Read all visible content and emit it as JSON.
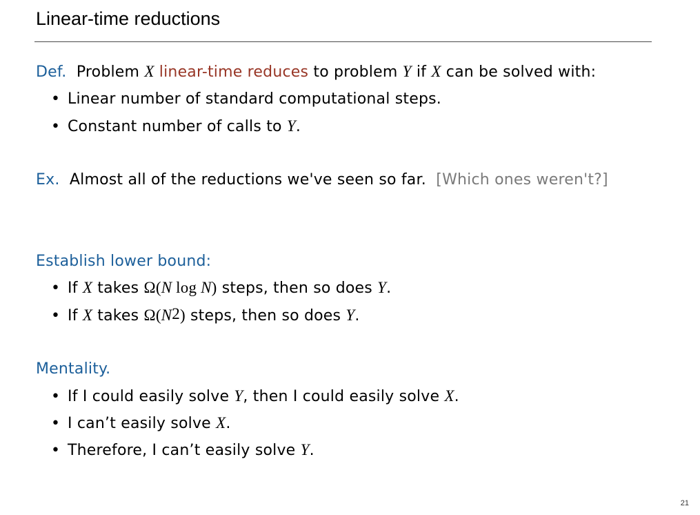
{
  "title": "Linear-time reductions",
  "definition": {
    "label": "Def.",
    "p1": "Problem ",
    "x": "X",
    "highlight": " linear-time reduces",
    "p2": " to problem ",
    "y": "Y",
    "p3": " if ",
    "x2": "X",
    "p4": " can be solved with:",
    "bullets": [
      {
        "text": "Linear number of standard computational steps."
      },
      {
        "pre": "Constant number of calls to ",
        "var": "Y",
        "post": "."
      }
    ]
  },
  "example": {
    "label": "Ex.",
    "text": " Almost all of the reductions we've seen so far.",
    "aside": "[Which ones weren't?]"
  },
  "lower_bound": {
    "heading": "Establish lower bound:",
    "b1": {
      "pre": "If ",
      "x": "X",
      "mid": " takes ",
      "omega": "Ω(",
      "n1": "N",
      "log": " log ",
      "n2": "N",
      "close": ")",
      "post": " steps, then so does ",
      "y": "Y",
      "end": "."
    },
    "b2": {
      "pre": "If ",
      "x": "X",
      "mid": " takes ",
      "omega": "Ω(",
      "n": "N",
      "exp": "2",
      "close": ")",
      "post": " steps, then so does ",
      "y": "Y",
      "end": "."
    }
  },
  "mentality": {
    "heading": "Mentality.",
    "b1": {
      "pre": "If I could easily solve ",
      "y": "Y",
      "mid": ", then I could easily solve ",
      "x": "X",
      "end": "."
    },
    "b2": {
      "pre": "I can’t easily solve ",
      "x": "X",
      "end": "."
    },
    "b3": {
      "pre": "Therefore, I can’t easily solve ",
      "y": "Y",
      "end": "."
    }
  },
  "page_number": "21",
  "colors": {
    "accent_blue": "#1c5f9a",
    "accent_red": "#983626",
    "aside_gray": "#7a7a7a"
  }
}
